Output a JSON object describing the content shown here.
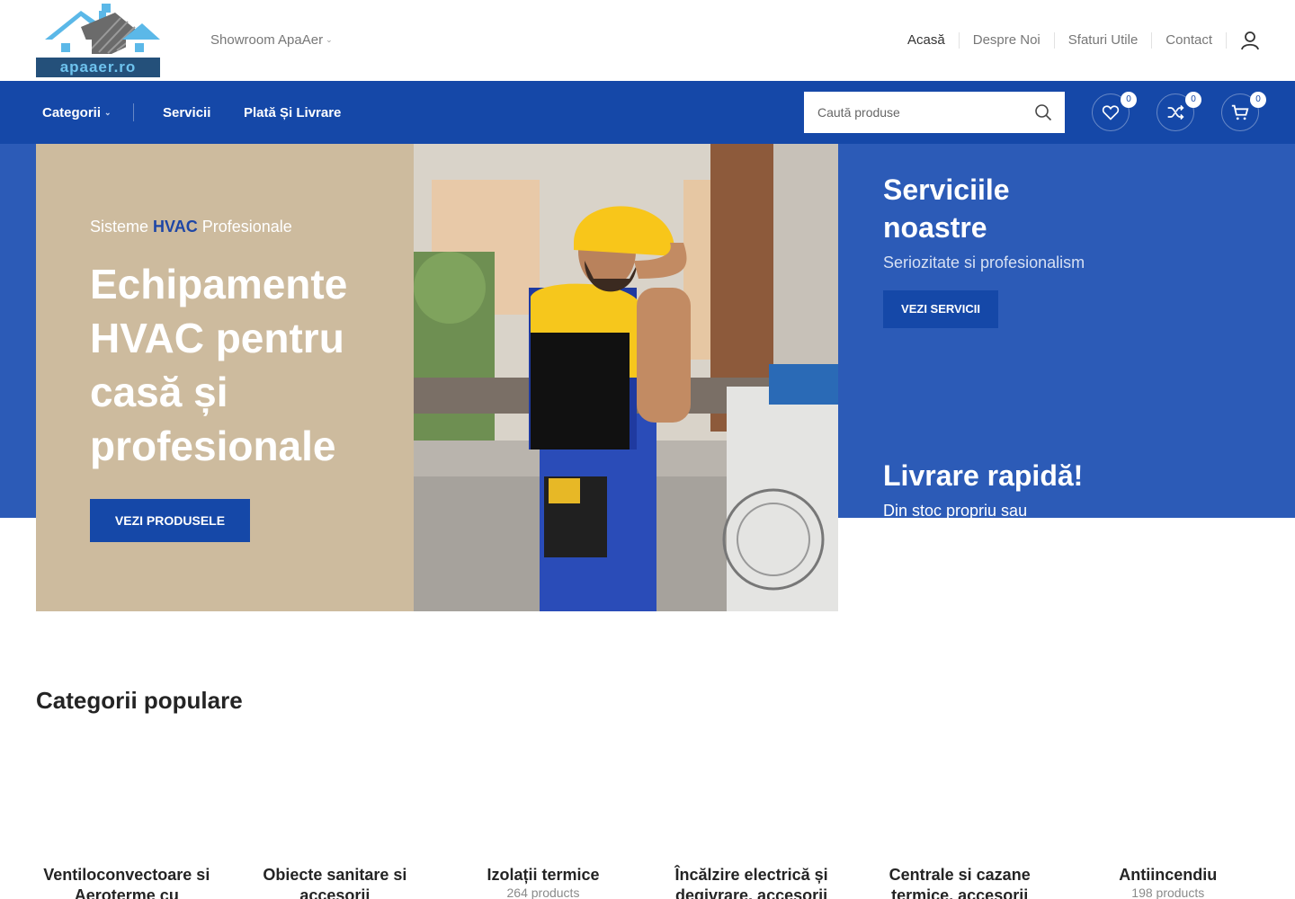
{
  "header": {
    "logo_text": "apaaer.ro",
    "showroom_label": "Showroom ApaAer",
    "nav": [
      "Acasă",
      "Despre Noi",
      "Sfaturi Utile",
      "Contact"
    ],
    "account_icon": "user-icon"
  },
  "main_nav": {
    "categories_label": "Categorii",
    "servicii_label": "Servicii",
    "plata_label": "Plată Și Livrare",
    "search_placeholder": "Caută produse",
    "wishlist_count": "0",
    "compare_count": "0",
    "cart_count": "0"
  },
  "hero": {
    "subtitle_pre": "Sisteme ",
    "subtitle_highlight": "HVAC",
    "subtitle_post": " Profesionale",
    "title": "Echipamente HVAC pentru casă și profesionale",
    "button_label": "VEZI PRODUSELE"
  },
  "services": {
    "title": "Serviciile noastre",
    "text": "Seriozitate si profesionalism",
    "button_label": "VEZI SERVICII"
  },
  "delivery": {
    "title": "Livrare rapidă!",
    "text": "Din stoc propriu sau"
  },
  "categories": {
    "heading": "Categorii populare",
    "items": [
      {
        "name": "Ventiloconvectoare si Aeroterme cu",
        "count": ""
      },
      {
        "name": "Obiecte sanitare si accesorii",
        "count": ""
      },
      {
        "name": "Izolații termice",
        "count": "264 products"
      },
      {
        "name": "Încălzire electrică și degivrare, accesorii",
        "count": ""
      },
      {
        "name": "Centrale si cazane termice, accesorii",
        "count": ""
      },
      {
        "name": "Antiincendiu",
        "count": "198 products"
      }
    ]
  },
  "colors": {
    "brand_blue": "#1548a8",
    "hero_blue": "#2c5bb7",
    "hero_beige": "#cdbb9e"
  }
}
